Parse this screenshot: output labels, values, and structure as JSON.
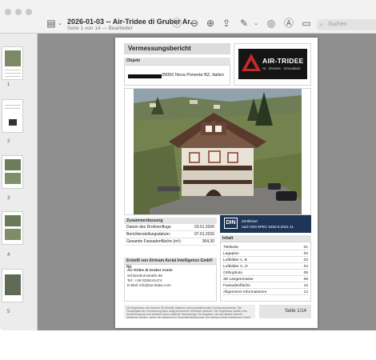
{
  "window": {
    "title": "2026-01-03 -- Air-Tridee di Gruber Ar...",
    "subtitle": "Seite 1 von 14 — Bearbeitet",
    "search_placeholder": "Suchen"
  },
  "toolbar": {
    "icons": [
      "sidebar-toggle-icon",
      "chevron-down-icon",
      "info-icon",
      "zoom-out-icon",
      "zoom-in-icon",
      "share-icon",
      "pen-icon",
      "chevron-down-icon",
      "markup-icon",
      "annotate-icon",
      "form-icon",
      "search-icon"
    ]
  },
  "sidebar": {
    "pages": [
      "1",
      "2",
      "3",
      "4",
      "5"
    ]
  },
  "document": {
    "heading": "Vermessungsbericht",
    "objekt_label": "Objekt",
    "address": "39050 Nova Ponente BZ, Italien",
    "logo": {
      "name": "AIR-TRIDEE",
      "tagline": "AI · Drones · Innovation"
    },
    "summary": {
      "label": "Zusammenfassung",
      "rows": [
        {
          "key": "Datum des Drohnenflugs:",
          "value": "03.01.2026"
        },
        {
          "key": "Berichterstellungsdatum:",
          "value": "07.01.2026"
        },
        {
          "key": "Gesamte Fassadenfläche (m²):",
          "value": "364,30"
        }
      ]
    },
    "creator": {
      "label": "Erstellt von Airteam Aerial Intelligence GmbH für",
      "company": "Air-Tridee di Gruber Armin",
      "street": "Schlosshurnstraße 98",
      "phone": "Tel.: +39 0336141474",
      "email": "E-Mail: info@air-tridee.com"
    },
    "din": {
      "logo": "DIN",
      "line1": "Zertifiziert",
      "line2": "nach DIN SPEC 5452-5:2021-11"
    },
    "toc": {
      "label": "Inhalt",
      "rows": [
        {
          "title": "Titelseite",
          "page": "01"
        },
        {
          "title": "Lageplan",
          "page": "02"
        },
        {
          "title": "Luftbilder A, B",
          "page": "03"
        },
        {
          "title": "Luftbilder C, D",
          "page": "04"
        },
        {
          "title": "Orthophoto",
          "page": "05"
        },
        {
          "title": "3D Längenmasse",
          "page": "06"
        },
        {
          "title": "Fassadenfläche",
          "page": "10"
        },
        {
          "title": "Allgemeine Informationen",
          "page": "14"
        }
      ]
    },
    "footer_text": "Die Ergebnisse des Airteam 3D-Modells basieren auf hochauflösenden Drohnenaufnahmen. Die Genauigkeit der Vermessung kann aufgrund äußerer Einflüsse variieren. Die Ergebnisse stellen eine Annäherung dar und ersetzen keine amtliche Vermessung. Für Angaben, die aus diesem Bericht abgeleitet werden, gelten die allgemeinen Geschäftsbedingungen der Airteam Aerial Intelligence GmbH.",
    "page_label": "Seite 1/14"
  },
  "colors": {
    "logo_red": "#c62828",
    "din_blue": "#1d3557"
  }
}
